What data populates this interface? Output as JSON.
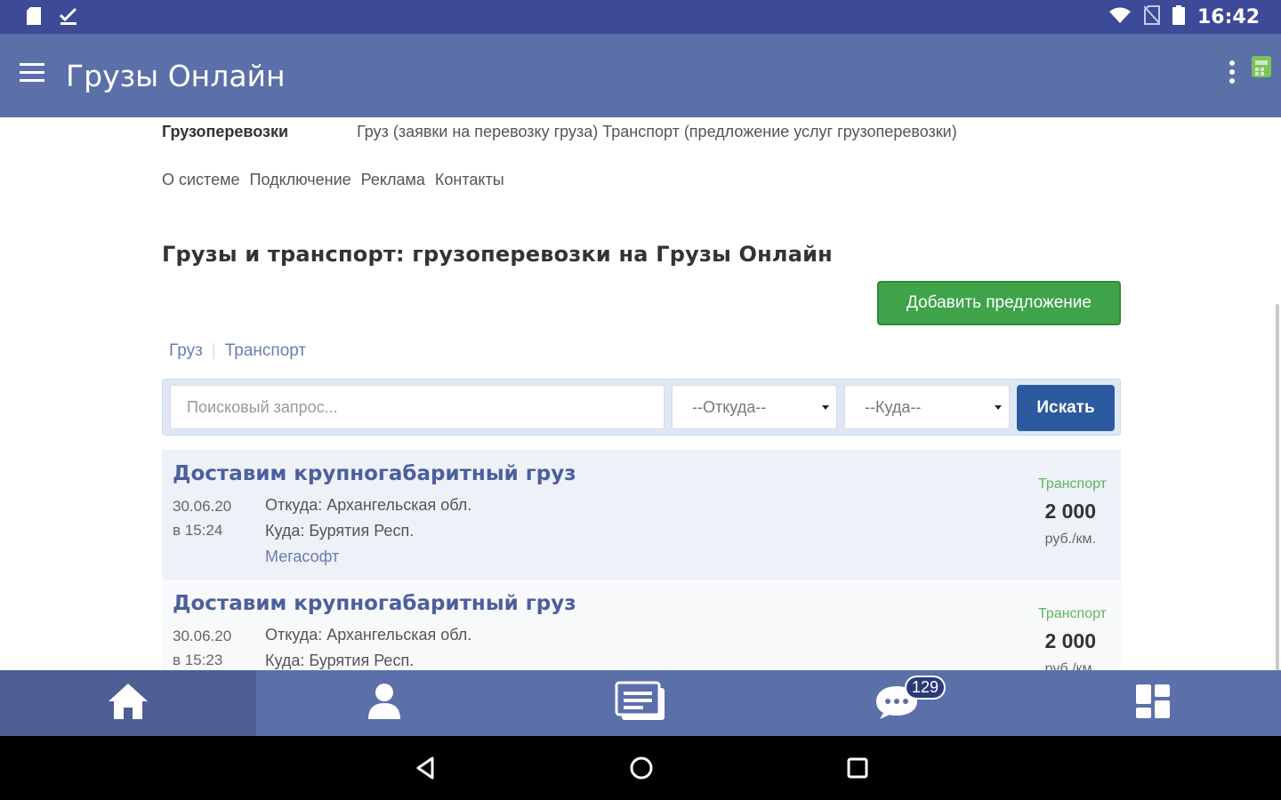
{
  "status_bar": {
    "time": "16:42",
    "icons": [
      "sd-card-icon",
      "check-icon",
      "wifi-icon",
      "no-sim-icon",
      "battery-icon"
    ]
  },
  "app_bar": {
    "title": "Грузы Онлайн",
    "icons": [
      "menu-icon",
      "more-vert-icon",
      "calculator-icon"
    ]
  },
  "site_nav": {
    "primary_label": "Грузоперевозки",
    "primary_links": [
      "Груз (заявки на перевозку груза)",
      "Транспорт (предложение услуг грузоперевозки)"
    ],
    "secondary_links": [
      "О системе",
      "Подключение",
      "Реклама",
      "Контакты"
    ]
  },
  "page": {
    "heading": "Грузы и транспорт: грузоперевозки на Грузы Онлайн",
    "add_button": "Добавить предложение"
  },
  "tabs": [
    "Груз",
    "Транспорт"
  ],
  "search": {
    "placeholder": "Поисковый запрос...",
    "from_select": "--Откуда--",
    "to_select": "--Куда--",
    "button": "Искать"
  },
  "listings": [
    {
      "title": "Доставим крупногабаритный груз",
      "date": "30.06.20",
      "time": "в 15:24",
      "from": "Откуда: Архангельская обл.",
      "to": "Куда: Бурятия Респ.",
      "company": "Мегасофт",
      "type": "Транспорт",
      "price": "2 000",
      "unit": "руб./км."
    },
    {
      "title": "Доставим крупногабаритный груз",
      "date": "30.06.20",
      "time": "в 15:23",
      "from": "Откуда: Архангельская обл.",
      "to": "Куда: Бурятия Респ.",
      "company": "",
      "type": "Транспорт",
      "price": "2 000",
      "unit": "руб./км."
    }
  ],
  "bottom_nav": {
    "tabs": [
      "home-icon",
      "profile-icon",
      "news-icon",
      "messages-icon",
      "dashboard-icon"
    ],
    "messages_badge": "129"
  },
  "colors": {
    "status_bar": "#3c4a97",
    "app_bar": "#5b6fa8",
    "add_button": "#3fa34a",
    "search_button": "#2b5aa0",
    "listing_title": "#4b5f9e",
    "type_label": "#5cb85c"
  }
}
